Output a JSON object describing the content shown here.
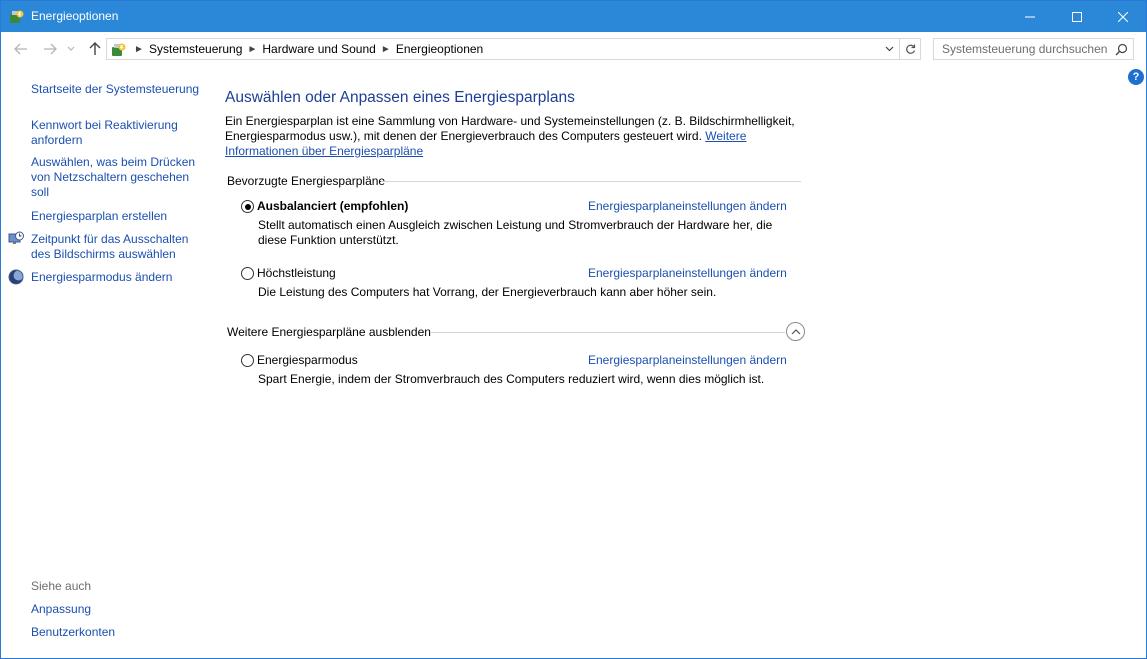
{
  "window": {
    "title": "Energieoptionen",
    "accent_color": "#2b88d8"
  },
  "address": {
    "crumbs": [
      "Systemsteuerung",
      "Hardware und Sound",
      "Energieoptionen"
    ],
    "search_placeholder": "Systemsteuerung durchsuchen"
  },
  "sidebar": {
    "home": "Startseite der Systemsteuerung",
    "items": [
      {
        "label": "Kennwort bei Reaktivierung anfordern",
        "icon": "none"
      },
      {
        "label": "Auswählen, was beim Drücken von Netzschaltern geschehen soll",
        "icon": "none"
      },
      {
        "label": "Energiesparplan erstellen",
        "icon": "none"
      },
      {
        "label": "Zeitpunkt für das Ausschalten des Bildschirms auswählen",
        "icon": "monitor-clock-icon"
      },
      {
        "label": "Energiesparmodus ändern",
        "icon": "moon-icon"
      }
    ],
    "see_also_label": "Siehe auch",
    "see_also": [
      "Anpassung",
      "Benutzerkonten"
    ]
  },
  "main": {
    "heading": "Auswählen oder Anpassen eines Energiesparplans",
    "intro_text": "Ein Energiesparplan ist eine Sammlung von Hardware- und Systemeinstellungen (z. B. Bildschirmhelligkeit, Energiesparmodus usw.), mit denen der Energieverbrauch des Computers gesteuert wird. ",
    "intro_link": "Weitere Informationen über Energiesparpläne",
    "preferred_title": "Bevorzugte Energiesparpläne",
    "more_title": "Weitere Energiesparpläne ausblenden",
    "plans": [
      {
        "name": "Ausbalanciert (empfohlen)",
        "selected": true,
        "link": "Energiesparplaneinstellungen ändern",
        "desc": "Stellt automatisch einen Ausgleich zwischen Leistung und Stromverbrauch der Hardware her, die diese Funktion unterstützt."
      },
      {
        "name": "Höchstleistung",
        "selected": false,
        "link": "Energiesparplaneinstellungen ändern",
        "desc": "Die Leistung des Computers hat Vorrang, der Energieverbrauch kann aber höher sein."
      },
      {
        "name": "Energiesparmodus",
        "selected": false,
        "link": "Energiesparplaneinstellungen ändern",
        "desc": "Spart Energie, indem der Stromverbrauch des Computers reduziert wird, wenn dies möglich ist."
      }
    ]
  }
}
